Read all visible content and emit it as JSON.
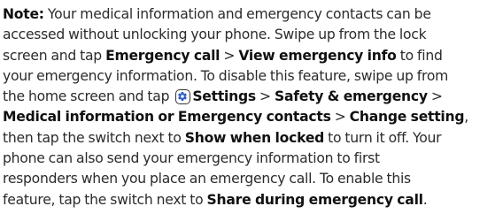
{
  "note": {
    "label": "Note:",
    "l1_text": " Your medical information and emergency contacts can be",
    "l2_text": "accessed without unlocking your phone. Swipe up from the lock",
    "l3_pre": "screen and tap ",
    "emergency_call": "Emergency call",
    "sep1": " > ",
    "view_emergency_info": "View emergency info",
    "l3_post": " to find",
    "l4_text": "your emergency information. To disable this feature, swipe up from",
    "l5_pre": "the home screen and tap ",
    "settings_icon": "gear-icon",
    "settings": "Settings",
    "sep2": " > ",
    "safety_emergency": "Safety & emergency",
    "sep3": " >",
    "medical_or_contacts": "Medical information or Emergency contacts",
    "sep4": " > ",
    "change_setting": "Change setting",
    "l6_post": ",",
    "l7_pre": "then tap the switch next to ",
    "show_when_locked": "Show when locked",
    "l7_post": " to turn it off. Your",
    "l8_text": "phone can also send your emergency information to first",
    "l9_text": "responders when you place an emergency call. To enable this",
    "l10_pre": "feature, tap the switch next to ",
    "share_during_emergency_call": "Share during emergency call",
    "l10_post": "."
  },
  "colors": {
    "text": "#2b2b2b",
    "bold_text": "#111111",
    "icon_fill": "#2f5fc4"
  }
}
